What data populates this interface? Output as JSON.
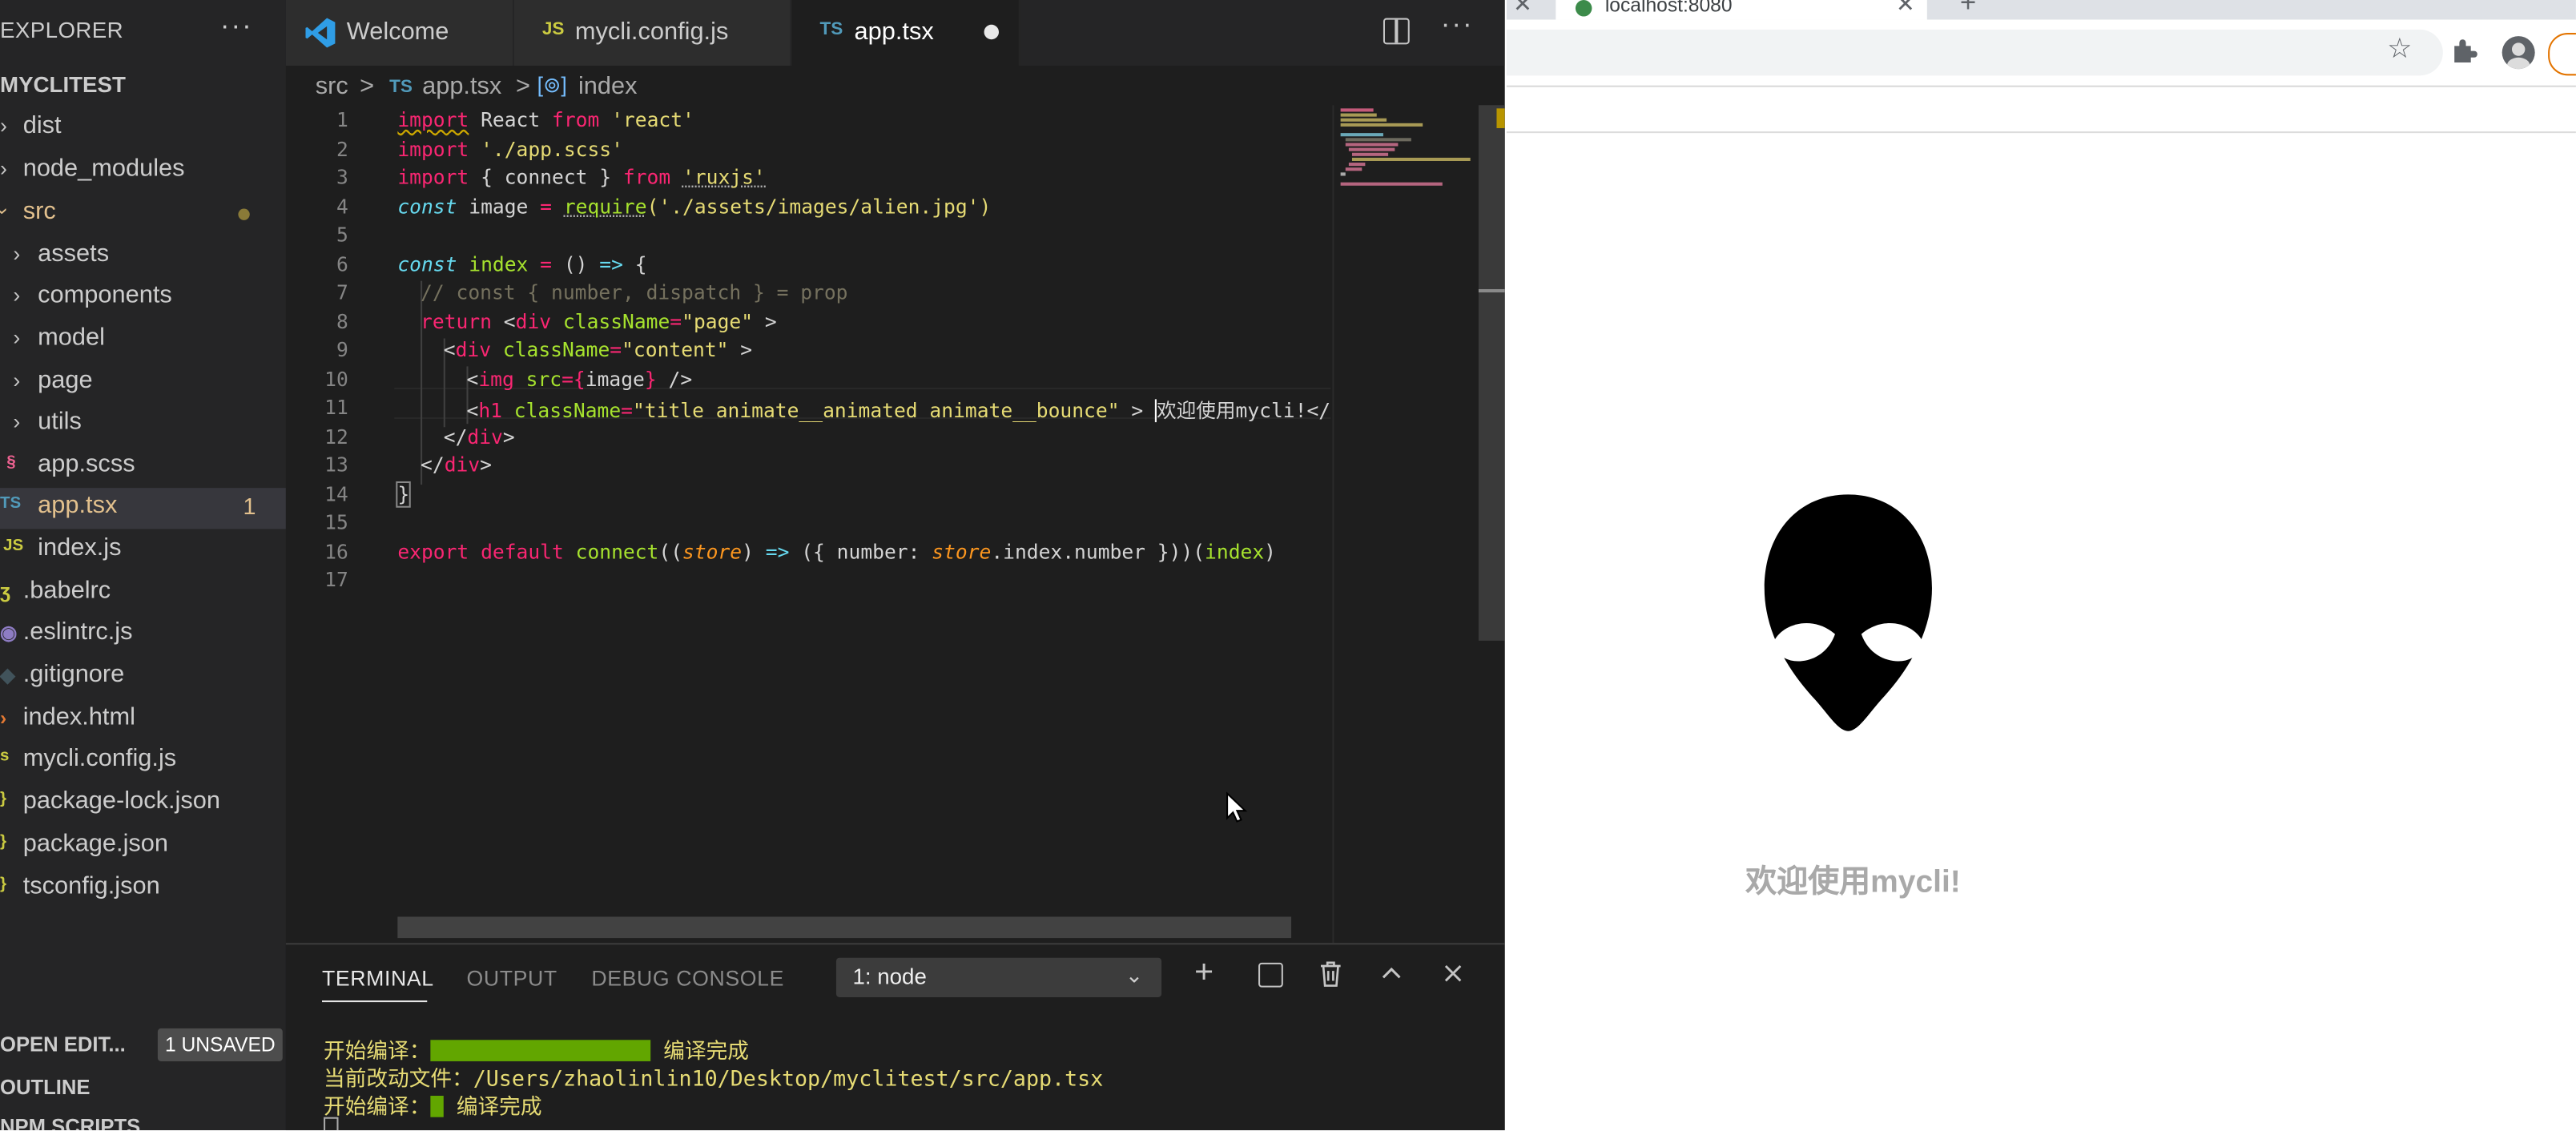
{
  "vscode": {
    "sidebar": {
      "title": "EXPLORER",
      "more": "···",
      "project": "MYCLITEST",
      "items": [
        {
          "label": "dist",
          "kind": "folder"
        },
        {
          "label": "node_modules",
          "kind": "folder"
        },
        {
          "label": "src",
          "kind": "folder-open"
        },
        {
          "label": "assets",
          "kind": "folder"
        },
        {
          "label": "components",
          "kind": "folder"
        },
        {
          "label": "model",
          "kind": "folder"
        },
        {
          "label": "page",
          "kind": "folder"
        },
        {
          "label": "utils",
          "kind": "folder"
        },
        {
          "label": "app.scss",
          "kind": "scss"
        },
        {
          "label": "app.tsx",
          "kind": "ts",
          "badge": "1"
        },
        {
          "label": "index.js",
          "kind": "js",
          "icon": "JS"
        },
        {
          "label": ".babelrc",
          "kind": "babel"
        },
        {
          "label": ".eslintrc.js",
          "kind": "eslint"
        },
        {
          "label": ".gitignore",
          "kind": "git"
        },
        {
          "label": "index.html",
          "kind": "html"
        },
        {
          "label": "mycli.config.js",
          "kind": "js"
        },
        {
          "label": "package-lock.json",
          "kind": "json"
        },
        {
          "label": "package.json",
          "kind": "json"
        },
        {
          "label": "tsconfig.json",
          "kind": "json"
        }
      ],
      "open_editors": "OPEN EDIT...",
      "unsaved_badge": "1 UNSAVED",
      "outline": "OUTLINE",
      "npm_scripts": "NPM SCRIPTS"
    },
    "tabs": [
      {
        "label": "Welcome",
        "icon": "vscode-icon"
      },
      {
        "label": "mycli.config.js",
        "icon": "JS"
      },
      {
        "label": "app.tsx",
        "icon": "TS",
        "active": true
      }
    ],
    "breadcrumb": {
      "folder": "src",
      "sep": ">",
      "file_icon": "TS",
      "file": "app.tsx",
      "symbol": "index"
    },
    "line_numbers": [
      "1",
      "2",
      "3",
      "4",
      "5",
      "6",
      "7",
      "8",
      "9",
      "10",
      "11",
      "12",
      "13",
      "14",
      "15",
      "16",
      "17"
    ],
    "code": {
      "l1_import": "import",
      "l1_react": " React ",
      "l1_from": "from",
      "l1_str": " 'react'",
      "l2_import": "import",
      "l2_str": " './app.scss'",
      "l3_import": "import",
      "l3_mid": " { connect } ",
      "l3_from": "from",
      "l3_sp": " ",
      "l3_str": "'ruxjs'",
      "l4_const": "const",
      "l4_mid": " image ",
      "l4_eq": "=",
      "l4_sp": " ",
      "l4_req": "require",
      "l4_str": "('./assets/images/alien.jpg')",
      "l6_const": "const",
      "l6_name": " index ",
      "l6_eq": "=",
      "l6_args": " () ",
      "l6_arrow": "=>",
      "l6_brace": " {",
      "l7_comment": "// const { number, dispatch } = prop",
      "l8_return": "return",
      "l8_lt": " <",
      "l8_tag": "div",
      "l8_attr": " className",
      "l8_eq": "=",
      "l8_val": "\"page\"",
      "l8_gt": " >",
      "l9_lt": "<",
      "l9_tag": "div",
      "l9_attr": " className",
      "l9_eq": "=",
      "l9_val": "\"content\"",
      "l9_gt": " >",
      "l10_lt": "<",
      "l10_tag": "img",
      "l10_attr": " src",
      "l10_eq": "=",
      "l10_open": "{",
      "l10_var": "image",
      "l10_close": "}",
      "l10_end": " />",
      "l11_lt": "<",
      "l11_tag": "h1",
      "l11_attr": " className",
      "l11_eq": "=",
      "l11_val": "\"title animate__animated animate__bounce\"",
      "l11_gt": " > ",
      "l11_text": "欢迎使用mycli!",
      "l11_close": "</",
      "l11_ctag": "h1",
      "l12_lt": "</",
      "l12_tag": "div",
      "l12_gt": ">",
      "l13_lt": "</",
      "l13_tag": "div",
      "l13_gt": ">",
      "l14_brace": "}",
      "l16_export": "export",
      "l16_default": " default ",
      "l16_connect": "connect",
      "l16_p1": "((",
      "l16_store": "store",
      "l16_p2": ") ",
      "l16_arrow": "=>",
      "l16_obj": " ({ number: ",
      "l16_store2": "store",
      "l16_rest": ".index.number }))(",
      "l16_index": "index",
      "l16_end": ")"
    },
    "panel": {
      "tabs": [
        "TERMINAL",
        "OUTPUT",
        "DEBUG CONSOLE"
      ],
      "terminal_select": "1: node",
      "lines": [
        {
          "prefix": "开始编译：",
          "suffix": " 编译完成"
        },
        {
          "text": "当前改动文件：/Users/zhaolinlin10/Desktop/myclitest/src/app.tsx"
        },
        {
          "prefix": "开始编译：",
          "suffix": " 编译完成"
        }
      ],
      "progress": [
        1.0,
        0.06
      ]
    }
  },
  "browser": {
    "tab_title": "localhost:8080",
    "heading": "欢迎使用mycli!"
  }
}
